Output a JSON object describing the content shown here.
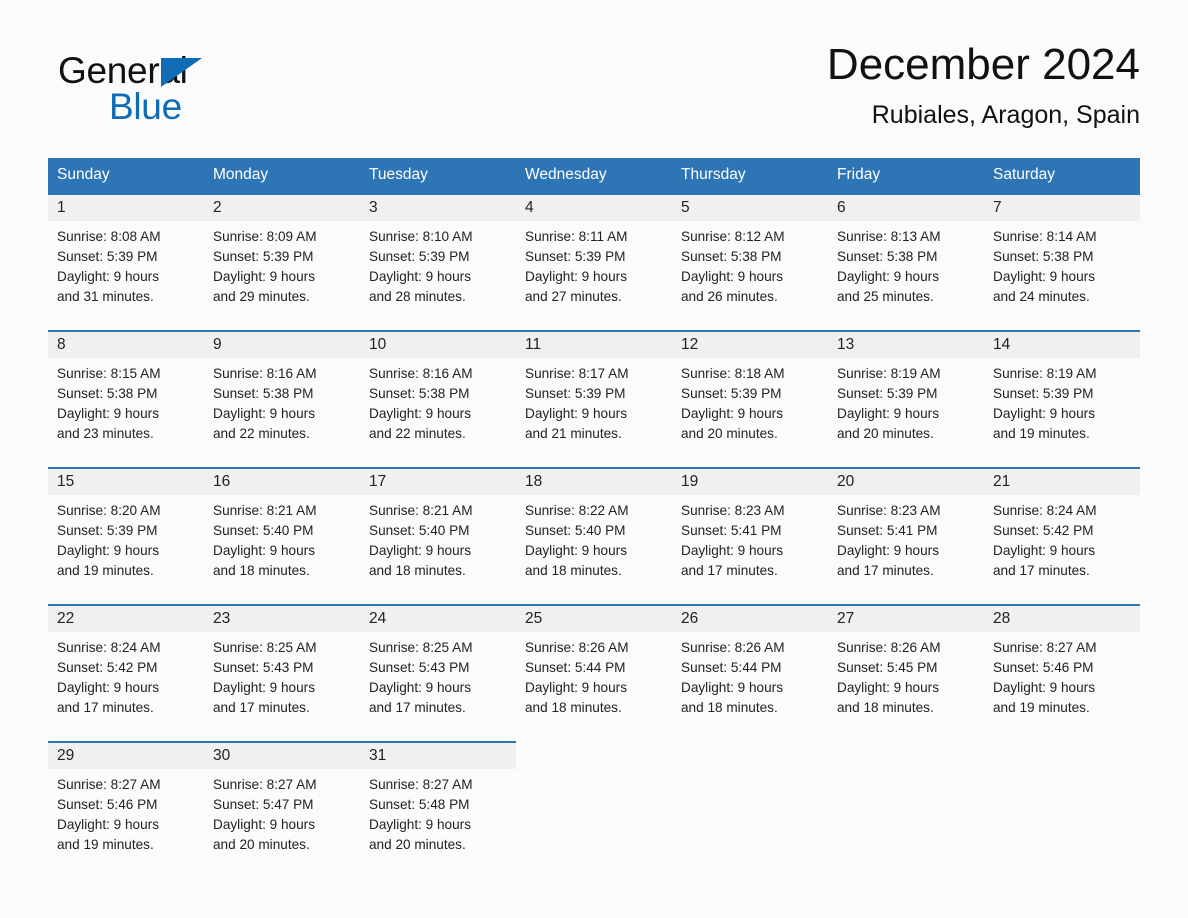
{
  "brand": {
    "name_part1": "General",
    "name_part2": "Blue",
    "triangle_icon": "blue-triangle-icon",
    "colors": {
      "black": "#111111",
      "blue": "#0f6cb5"
    }
  },
  "header": {
    "title": "December 2024",
    "subtitle": "Rubiales, Aragon, Spain"
  },
  "theme": {
    "header_blue": "#2e75b6",
    "daynum_gray": "#f0f0f0",
    "page_background": "#fbfbfb",
    "text": "#222222"
  },
  "weekday_headers": [
    "Sunday",
    "Monday",
    "Tuesday",
    "Wednesday",
    "Thursday",
    "Friday",
    "Saturday"
  ],
  "weeks": [
    [
      {
        "day": "1",
        "sunrise": "Sunrise: 8:08 AM",
        "sunset": "Sunset: 5:39 PM",
        "daylight1": "Daylight: 9 hours",
        "daylight2": "and 31 minutes."
      },
      {
        "day": "2",
        "sunrise": "Sunrise: 8:09 AM",
        "sunset": "Sunset: 5:39 PM",
        "daylight1": "Daylight: 9 hours",
        "daylight2": "and 29 minutes."
      },
      {
        "day": "3",
        "sunrise": "Sunrise: 8:10 AM",
        "sunset": "Sunset: 5:39 PM",
        "daylight1": "Daylight: 9 hours",
        "daylight2": "and 28 minutes."
      },
      {
        "day": "4",
        "sunrise": "Sunrise: 8:11 AM",
        "sunset": "Sunset: 5:39 PM",
        "daylight1": "Daylight: 9 hours",
        "daylight2": "and 27 minutes."
      },
      {
        "day": "5",
        "sunrise": "Sunrise: 8:12 AM",
        "sunset": "Sunset: 5:38 PM",
        "daylight1": "Daylight: 9 hours",
        "daylight2": "and 26 minutes."
      },
      {
        "day": "6",
        "sunrise": "Sunrise: 8:13 AM",
        "sunset": "Sunset: 5:38 PM",
        "daylight1": "Daylight: 9 hours",
        "daylight2": "and 25 minutes."
      },
      {
        "day": "7",
        "sunrise": "Sunrise: 8:14 AM",
        "sunset": "Sunset: 5:38 PM",
        "daylight1": "Daylight: 9 hours",
        "daylight2": "and 24 minutes."
      }
    ],
    [
      {
        "day": "8",
        "sunrise": "Sunrise: 8:15 AM",
        "sunset": "Sunset: 5:38 PM",
        "daylight1": "Daylight: 9 hours",
        "daylight2": "and 23 minutes."
      },
      {
        "day": "9",
        "sunrise": "Sunrise: 8:16 AM",
        "sunset": "Sunset: 5:38 PM",
        "daylight1": "Daylight: 9 hours",
        "daylight2": "and 22 minutes."
      },
      {
        "day": "10",
        "sunrise": "Sunrise: 8:16 AM",
        "sunset": "Sunset: 5:38 PM",
        "daylight1": "Daylight: 9 hours",
        "daylight2": "and 22 minutes."
      },
      {
        "day": "11",
        "sunrise": "Sunrise: 8:17 AM",
        "sunset": "Sunset: 5:39 PM",
        "daylight1": "Daylight: 9 hours",
        "daylight2": "and 21 minutes."
      },
      {
        "day": "12",
        "sunrise": "Sunrise: 8:18 AM",
        "sunset": "Sunset: 5:39 PM",
        "daylight1": "Daylight: 9 hours",
        "daylight2": "and 20 minutes."
      },
      {
        "day": "13",
        "sunrise": "Sunrise: 8:19 AM",
        "sunset": "Sunset: 5:39 PM",
        "daylight1": "Daylight: 9 hours",
        "daylight2": "and 20 minutes."
      },
      {
        "day": "14",
        "sunrise": "Sunrise: 8:19 AM",
        "sunset": "Sunset: 5:39 PM",
        "daylight1": "Daylight: 9 hours",
        "daylight2": "and 19 minutes."
      }
    ],
    [
      {
        "day": "15",
        "sunrise": "Sunrise: 8:20 AM",
        "sunset": "Sunset: 5:39 PM",
        "daylight1": "Daylight: 9 hours",
        "daylight2": "and 19 minutes."
      },
      {
        "day": "16",
        "sunrise": "Sunrise: 8:21 AM",
        "sunset": "Sunset: 5:40 PM",
        "daylight1": "Daylight: 9 hours",
        "daylight2": "and 18 minutes."
      },
      {
        "day": "17",
        "sunrise": "Sunrise: 8:21 AM",
        "sunset": "Sunset: 5:40 PM",
        "daylight1": "Daylight: 9 hours",
        "daylight2": "and 18 minutes."
      },
      {
        "day": "18",
        "sunrise": "Sunrise: 8:22 AM",
        "sunset": "Sunset: 5:40 PM",
        "daylight1": "Daylight: 9 hours",
        "daylight2": "and 18 minutes."
      },
      {
        "day": "19",
        "sunrise": "Sunrise: 8:23 AM",
        "sunset": "Sunset: 5:41 PM",
        "daylight1": "Daylight: 9 hours",
        "daylight2": "and 17 minutes."
      },
      {
        "day": "20",
        "sunrise": "Sunrise: 8:23 AM",
        "sunset": "Sunset: 5:41 PM",
        "daylight1": "Daylight: 9 hours",
        "daylight2": "and 17 minutes."
      },
      {
        "day": "21",
        "sunrise": "Sunrise: 8:24 AM",
        "sunset": "Sunset: 5:42 PM",
        "daylight1": "Daylight: 9 hours",
        "daylight2": "and 17 minutes."
      }
    ],
    [
      {
        "day": "22",
        "sunrise": "Sunrise: 8:24 AM",
        "sunset": "Sunset: 5:42 PM",
        "daylight1": "Daylight: 9 hours",
        "daylight2": "and 17 minutes."
      },
      {
        "day": "23",
        "sunrise": "Sunrise: 8:25 AM",
        "sunset": "Sunset: 5:43 PM",
        "daylight1": "Daylight: 9 hours",
        "daylight2": "and 17 minutes."
      },
      {
        "day": "24",
        "sunrise": "Sunrise: 8:25 AM",
        "sunset": "Sunset: 5:43 PM",
        "daylight1": "Daylight: 9 hours",
        "daylight2": "and 17 minutes."
      },
      {
        "day": "25",
        "sunrise": "Sunrise: 8:26 AM",
        "sunset": "Sunset: 5:44 PM",
        "daylight1": "Daylight: 9 hours",
        "daylight2": "and 18 minutes."
      },
      {
        "day": "26",
        "sunrise": "Sunrise: 8:26 AM",
        "sunset": "Sunset: 5:44 PM",
        "daylight1": "Daylight: 9 hours",
        "daylight2": "and 18 minutes."
      },
      {
        "day": "27",
        "sunrise": "Sunrise: 8:26 AM",
        "sunset": "Sunset: 5:45 PM",
        "daylight1": "Daylight: 9 hours",
        "daylight2": "and 18 minutes."
      },
      {
        "day": "28",
        "sunrise": "Sunrise: 8:27 AM",
        "sunset": "Sunset: 5:46 PM",
        "daylight1": "Daylight: 9 hours",
        "daylight2": "and 19 minutes."
      }
    ],
    [
      {
        "day": "29",
        "sunrise": "Sunrise: 8:27 AM",
        "sunset": "Sunset: 5:46 PM",
        "daylight1": "Daylight: 9 hours",
        "daylight2": "and 19 minutes."
      },
      {
        "day": "30",
        "sunrise": "Sunrise: 8:27 AM",
        "sunset": "Sunset: 5:47 PM",
        "daylight1": "Daylight: 9 hours",
        "daylight2": "and 20 minutes."
      },
      {
        "day": "31",
        "sunrise": "Sunrise: 8:27 AM",
        "sunset": "Sunset: 5:48 PM",
        "daylight1": "Daylight: 9 hours",
        "daylight2": "and 20 minutes."
      },
      {
        "day": "",
        "sunrise": "",
        "sunset": "",
        "daylight1": "",
        "daylight2": ""
      },
      {
        "day": "",
        "sunrise": "",
        "sunset": "",
        "daylight1": "",
        "daylight2": ""
      },
      {
        "day": "",
        "sunrise": "",
        "sunset": "",
        "daylight1": "",
        "daylight2": ""
      },
      {
        "day": "",
        "sunrise": "",
        "sunset": "",
        "daylight1": "",
        "daylight2": ""
      }
    ]
  ]
}
